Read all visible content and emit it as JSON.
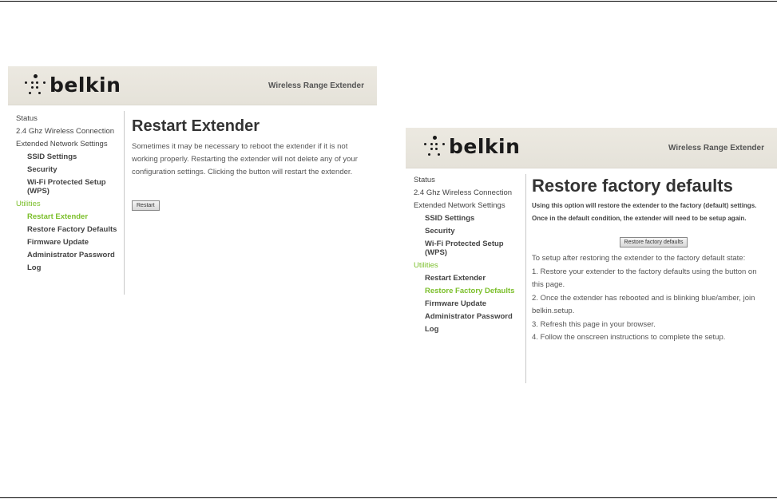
{
  "brand": {
    "logo_text": "belkin",
    "product": "Wireless Range Extender"
  },
  "restart_panel": {
    "nav": {
      "status": "Status",
      "wireless": "2.4 Ghz Wireless Connection",
      "extended": "Extended Network Settings",
      "ssid": "SSID Settings",
      "security": "Security",
      "wps_line1": "Wi-Fi Protected Setup",
      "wps_line2": "(WPS)",
      "utilities": "Utilities",
      "restart": "Restart Extender",
      "restore": "Restore Factory Defaults",
      "firmware": "Firmware Update",
      "admin": "Administrator Password",
      "log": "Log"
    },
    "title": "Restart Extender",
    "body": "Sometimes it may be necessary to reboot the extender if it is not working properly. Restarting the extender will not delete any of your configuration settings. Clicking the button will restart the extender.",
    "button_label": "Restart"
  },
  "restore_panel": {
    "nav": {
      "status": "Status",
      "wireless": "2.4 Ghz Wireless Connection",
      "extended": "Extended Network Settings",
      "ssid": "SSID Settings",
      "security": "Security",
      "wps_line1": "Wi-Fi Protected Setup",
      "wps_line2": "(WPS)",
      "utilities": "Utilities",
      "restart": "Restart Extender",
      "restore": "Restore Factory Defaults",
      "firmware": "Firmware Update",
      "admin": "Administrator Password",
      "log": "Log"
    },
    "title": "Restore factory defaults",
    "warning_line1": "Using this option will restore the extender to the factory (default) settings.",
    "warning_line2": "Once in the default condition, the extender will need to be setup again.",
    "button_label": "Restore factory defaults",
    "steps": [
      "To setup after restoring the extender to the factory default state:",
      "1. Restore your extender to the factory defaults using the button on",
      "this page.",
      "2. Once the extender has rebooted and is blinking blue/amber, join",
      "belkin.setup.",
      "3. Refresh this page in your browser.",
      "4. Follow the onscreen instructions to complete the setup."
    ]
  },
  "colors": {
    "accent_green": "#7bbf2a",
    "header_bg": "#ece9e1"
  }
}
